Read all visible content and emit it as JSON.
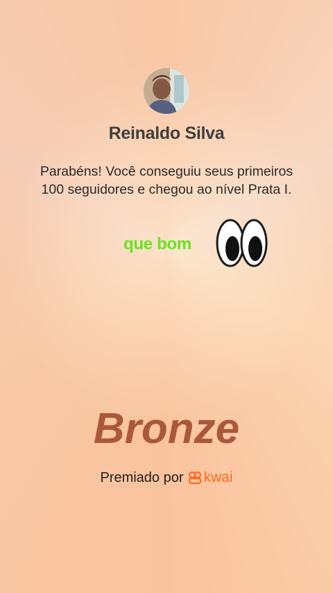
{
  "user": {
    "name": "Reinaldo Silva"
  },
  "message": "Parabéns! Você conseguiu seus primeiros 100 seguidores e chegou ao nível Prata I.",
  "sticker": {
    "text": "que bom",
    "icon": "eyes-emoji"
  },
  "level": "Bronze",
  "footer": {
    "awarded_by": "Premiado por",
    "brand": "kwai",
    "brand_icon": "kwai-logo-icon",
    "brand_color": "#ff6a1f"
  }
}
